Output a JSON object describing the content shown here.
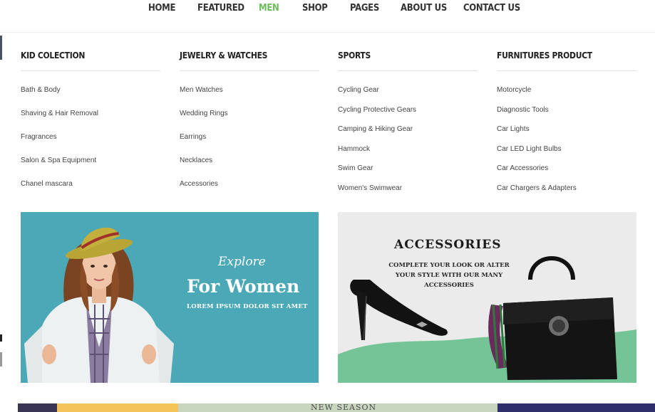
{
  "nav": {
    "items": [
      {
        "label": "HOME",
        "active": false
      },
      {
        "label": "FEATURED",
        "active": false
      },
      {
        "label": "MEN",
        "active": true
      },
      {
        "label": "SHOP",
        "active": false
      },
      {
        "label": "PAGES",
        "active": false
      },
      {
        "label": "ABOUT US",
        "active": false
      },
      {
        "label": "CONTACT US",
        "active": false
      }
    ],
    "active_color": "#6dbc5a"
  },
  "mega_menu": {
    "columns": [
      {
        "title": "KID COLECTION",
        "links": [
          "Bath & Body",
          "Shaving & Hair Removal",
          "Fragrances",
          "Salon & Spa Equipment",
          "Chanel mascara"
        ]
      },
      {
        "title": "JEWELRY & WATCHES",
        "links": [
          "Men Watches",
          "Wedding Rings",
          "Earrings",
          "Necklaces",
          "Accessories"
        ]
      },
      {
        "title": "SPORTS",
        "links": [
          "Cycling Gear",
          "Cycling Protective Gears",
          "Camping & Hiking Gear",
          "Hammock",
          "Swim Gear",
          "Women's Swimwear"
        ]
      },
      {
        "title": "FURNITURES PRODUCT",
        "links": [
          "Motorcycle",
          "Diagnostic Tools",
          "Car Lights",
          "Car LED Light Bulbs",
          "Car Accessories",
          "Car Chargers & Adapters"
        ]
      }
    ],
    "banners": {
      "women": {
        "script": "Explore",
        "title": "For Women",
        "subtitle": "LOREM IPSUM DOLOR SIT AMET",
        "bg": "#4ba9b7"
      },
      "accessories": {
        "title": "ACCESSORIES",
        "subtitle": "COMPLETE YOUR LOOK OR ALTER YOUR STYLE WITH OUR MANY ACCESSORIES",
        "bg": "#ebebeb",
        "wave": "#74c497"
      }
    }
  },
  "background": {
    "bottom_text": "NEW SEASON"
  }
}
